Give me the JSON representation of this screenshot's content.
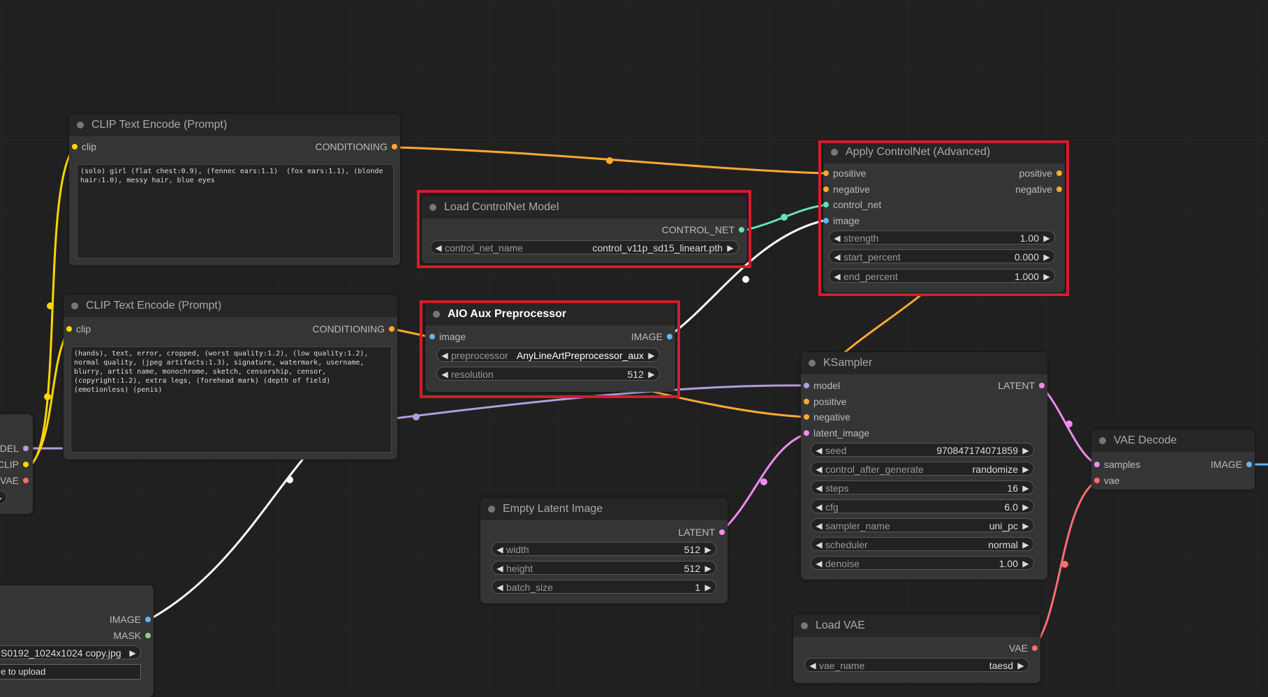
{
  "colors": {
    "clip": "#ffd500",
    "conditioning": "#ffa931",
    "control_net": "#64e3b3",
    "image": "#64b5f6",
    "model": "#b39ddb",
    "latent": "#f08cf0",
    "vae": "#ff6e6e",
    "highlight": "#d41c2a"
  },
  "clip_pos": {
    "title": "CLIP Text Encode (Prompt)",
    "in": "clip",
    "out": "CONDITIONING",
    "text": "(solo) girl (flat chest:0.9), (fennec ears:1.1)  (fox ears:1.1), (blonde\nhair:1.0), messy hair, blue eyes"
  },
  "clip_neg": {
    "title": "CLIP Text Encode (Prompt)",
    "in": "clip",
    "out": "CONDITIONING",
    "text": "(hands), text, error, cropped, (worst quality:1.2), (low quality:1.2),\nnormal quality, (jpeg artifacts:1.3), signature, watermark, username,\nblurry, artist name, monochrome, sketch, censorship, censor,\n(copyright:1.2), extra legs, (forehead mark) (depth of field)\n(emotionless) (penis)"
  },
  "controlnet_loader": {
    "title": "Load ControlNet Model",
    "out": "CONTROL_NET",
    "w_label": "control_net_name",
    "w_value": "control_v11p_sd15_lineart.pth"
  },
  "aio": {
    "title": "AIO Aux Preprocessor",
    "in": "image",
    "out": "IMAGE",
    "w1_label": "preprocessor",
    "w1_value": "AnyLineArtPreprocessor_aux",
    "w2_label": "resolution",
    "w2_value": "512"
  },
  "apply_cn": {
    "title": "Apply ControlNet (Advanced)",
    "in1": "positive",
    "in2": "negative",
    "in3": "control_net",
    "in4": "image",
    "out1": "positive",
    "out2": "negative",
    "widgets": [
      {
        "label": "strength",
        "value": "1.00"
      },
      {
        "label": "start_percent",
        "value": "0.000"
      },
      {
        "label": "end_percent",
        "value": "1.000"
      }
    ]
  },
  "ksampler": {
    "title": "KSampler",
    "in1": "model",
    "in2": "positive",
    "in3": "negative",
    "in4": "latent_image",
    "out": "LATENT",
    "widgets": [
      {
        "label": "seed",
        "value": "970847174071859"
      },
      {
        "label": "control_after_generate",
        "value": "randomize"
      },
      {
        "label": "steps",
        "value": "16"
      },
      {
        "label": "cfg",
        "value": "6.0"
      },
      {
        "label": "sampler_name",
        "value": "uni_pc"
      },
      {
        "label": "scheduler",
        "value": "normal"
      },
      {
        "label": "denoise",
        "value": "1.00"
      }
    ]
  },
  "empty_latent": {
    "title": "Empty Latent Image",
    "out": "LATENT",
    "widgets": [
      {
        "label": "width",
        "value": "512"
      },
      {
        "label": "height",
        "value": "512"
      },
      {
        "label": "batch_size",
        "value": "1"
      }
    ]
  },
  "vae_decode": {
    "title": "VAE Decode",
    "in1": "samples",
    "in2": "vae",
    "out": "IMAGE"
  },
  "load_vae": {
    "title": "Load VAE",
    "out": "VAE",
    "w_label": "vae_name",
    "w_value": "taesd"
  },
  "checkpoint": {
    "out1": "DEL",
    "out2": "CLIP",
    "out3": "VAE"
  },
  "load_image": {
    "out1": "IMAGE",
    "out2": "MASK",
    "w_value": "S0192_1024x1024 copy.jpg",
    "upload": "e to upload"
  }
}
